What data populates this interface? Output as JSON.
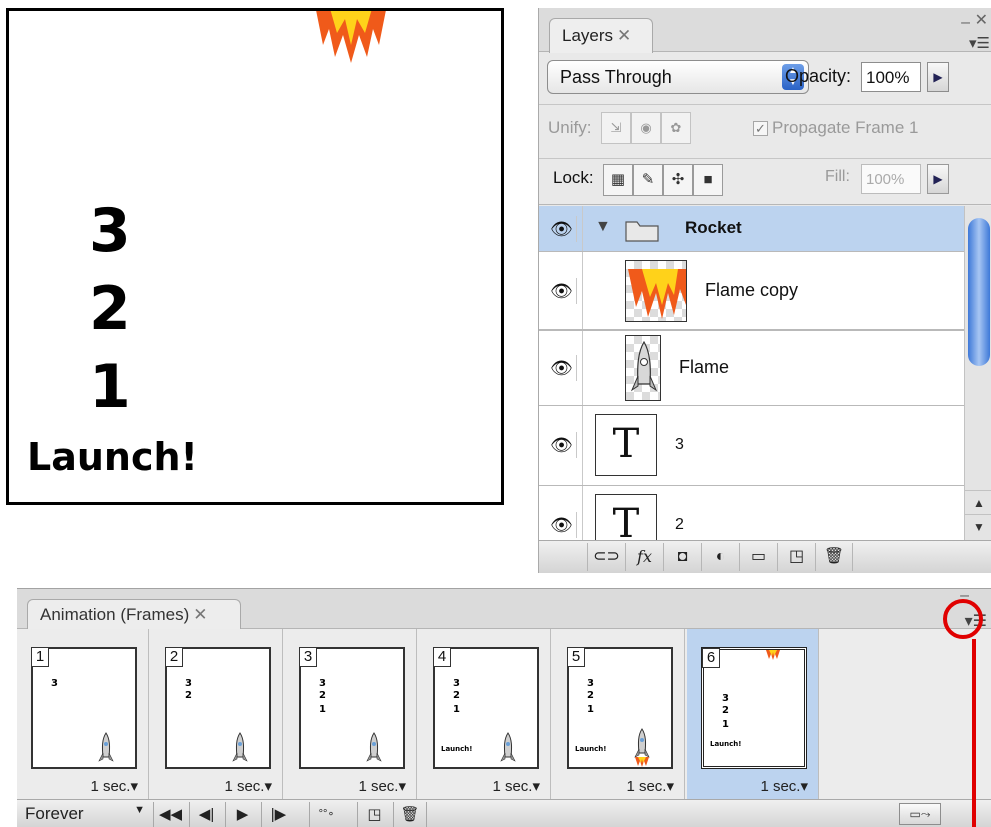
{
  "canvas": {
    "countdown": [
      "3",
      "2",
      "1"
    ],
    "launch": "Launch!"
  },
  "layers_panel": {
    "tab_label": "Layers",
    "blend_mode": "Pass Through",
    "opacity_label": "Opacity:",
    "opacity_value": "100%",
    "unify_label": "Unify:",
    "propagate_label": "Propagate Frame 1",
    "lock_label": "Lock:",
    "fill_label": "Fill:",
    "fill_value": "100%",
    "layers": [
      {
        "name": "Rocket",
        "type": "group",
        "visible": true,
        "selected": true
      },
      {
        "name": "Flame copy",
        "type": "image",
        "visible": true
      },
      {
        "name": "Flame",
        "type": "image",
        "visible": true
      },
      {
        "name": "3",
        "type": "text",
        "visible": true
      },
      {
        "name": "2",
        "type": "text",
        "visible": true
      }
    ],
    "bottom_icons": [
      "link-icon",
      "fx-icon",
      "mask-icon",
      "adjustment-icon",
      "group-icon",
      "new-layer-icon",
      "trash-icon"
    ],
    "fx_label": "fx"
  },
  "animation_panel": {
    "tab_label": "Animation (Frames)",
    "frames": [
      {
        "num": "1",
        "delay": "1 sec.",
        "text": [
          "3"
        ],
        "launch": "",
        "flame": false
      },
      {
        "num": "2",
        "delay": "1 sec.",
        "text": [
          "3",
          "2"
        ],
        "launch": "",
        "flame": false
      },
      {
        "num": "3",
        "delay": "1 sec.",
        "text": [
          "3",
          "2",
          "1"
        ],
        "launch": "",
        "flame": false
      },
      {
        "num": "4",
        "delay": "1 sec.",
        "text": [
          "3",
          "2",
          "1"
        ],
        "launch": "Launch!",
        "flame": false
      },
      {
        "num": "5",
        "delay": "1 sec.",
        "text": [
          "3",
          "2",
          "1"
        ],
        "launch": "Launch!",
        "flame": true
      },
      {
        "num": "6",
        "delay": "1 sec.",
        "text": [
          "3",
          "2",
          "1"
        ],
        "launch": "Launch!",
        "flame": true,
        "selected": true
      }
    ],
    "loop_option": "Forever",
    "controls": [
      "first-frame-icon",
      "prev-frame-icon",
      "play-icon",
      "next-frame-icon",
      "tween-icon",
      "duplicate-frame-icon",
      "trash-icon"
    ]
  },
  "colors": {
    "selection": "#bcd3ef",
    "highlight_annotation": "#e00000",
    "flame_orange": "#f05a1a",
    "flame_yellow": "#ffd21a"
  }
}
